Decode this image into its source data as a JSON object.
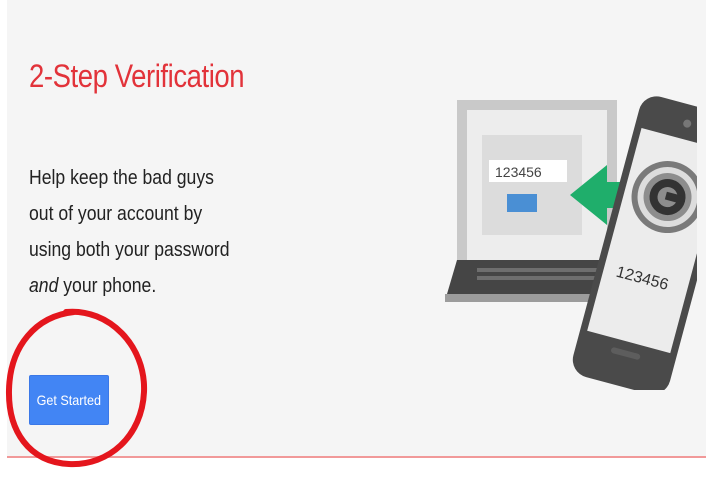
{
  "section": {
    "title": "2-Step Verification",
    "description_before": "Help keep the bad guys out of your account by using both your password ",
    "description_emphasis": "and",
    "description_after": " your phone."
  },
  "cta": {
    "label": "Get Started"
  },
  "illustration": {
    "laptop_code": "123456",
    "phone_code": "123456",
    "icons": [
      "laptop-icon",
      "phone-icon",
      "arrow-left-icon",
      "authenticator-icon"
    ]
  },
  "annotation": {
    "color": "#e4161d"
  },
  "colors": {
    "title": "#e2333a",
    "button": "#4285f4",
    "arrow": "#1fae6b",
    "panel": "#f5f5f5"
  }
}
